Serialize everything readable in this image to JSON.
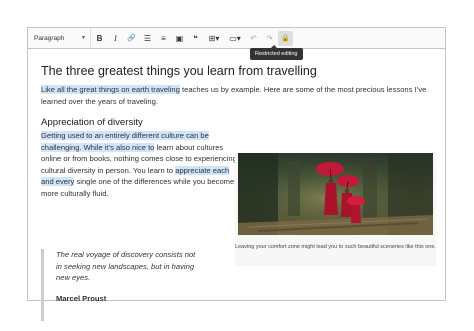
{
  "toolbar": {
    "heading_value": "Paragraph",
    "buttons": [
      {
        "name": "bold-button",
        "icon": "bold-icon",
        "glyph": "B"
      },
      {
        "name": "italic-button",
        "icon": "italic-icon",
        "glyph": "I"
      },
      {
        "name": "link-button",
        "icon": "link-icon",
        "glyph": "🔗"
      },
      {
        "name": "bulleted-list-button",
        "icon": "bulleted-list-icon",
        "glyph": "☰"
      },
      {
        "name": "numbered-list-button",
        "icon": "numbered-list-icon",
        "glyph": "≡"
      },
      {
        "name": "image-button",
        "icon": "image-icon",
        "glyph": "▣"
      },
      {
        "name": "blockquote-button",
        "icon": "blockquote-icon",
        "glyph": "❝"
      },
      {
        "name": "table-button",
        "icon": "table-icon",
        "glyph": "⊞▾"
      },
      {
        "name": "media-button",
        "icon": "media-icon",
        "glyph": "▭▾"
      },
      {
        "name": "undo-button",
        "icon": "undo-icon",
        "glyph": "↶"
      },
      {
        "name": "redo-button",
        "icon": "redo-icon",
        "glyph": "↷"
      },
      {
        "name": "restricted-editing-button",
        "icon": "restricted-editing-icon",
        "glyph": "🔒"
      }
    ],
    "tooltip": "Restricted editing"
  },
  "content": {
    "title": "The three greatest things you learn from travelling",
    "intro_highlight": "Like all the great things on earth traveling",
    "intro_rest": " teaches us by example. Here are some of the most precious lessons I’ve learned over the years of traveling.",
    "subtitle": "Appreciation of diversity",
    "para_highlight_1": "Getting used to an entirely different culture can be challenging. While it’s also nice to",
    "para_middle": " learn about cultures online or from books, nothing comes close to experiencing cultural diversity in person. You learn to ",
    "para_highlight_2": "appreciate each and every",
    "para_end": " single one of the differences while you become more culturally fluid.",
    "figure_caption": "Leaving your comfort zone might lead you to such beautiful sceneries like this one.",
    "quote_text": "The real voyage of discovery consists not in seeking new landscapes, but in having new eyes.",
    "quote_author": "Marcel Proust"
  },
  "colors": {
    "highlight": "#cfe5fb",
    "umbrella": "#c2183a",
    "robe": "#a8132b"
  }
}
